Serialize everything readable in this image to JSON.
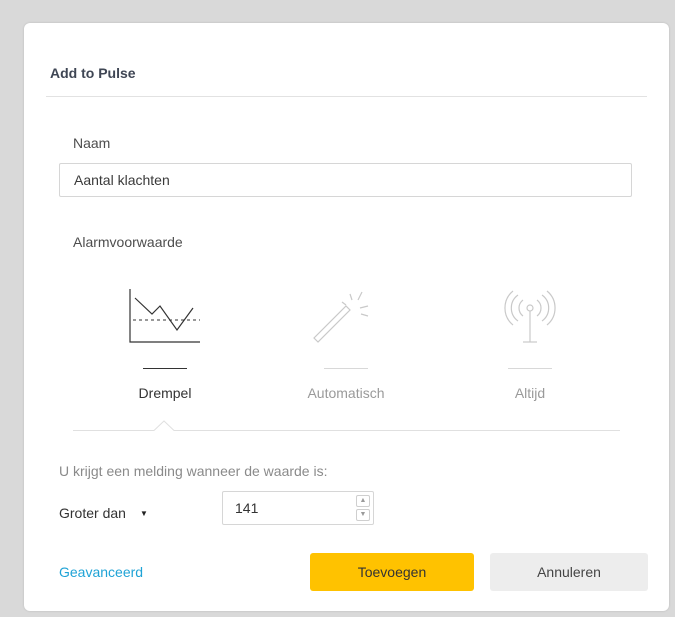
{
  "dialog": {
    "title": "Add to Pulse"
  },
  "name_field": {
    "label": "Naam",
    "value": "Aantal klachten"
  },
  "alarm": {
    "label": "Alarmvoorwaarde",
    "options": [
      {
        "label": "Drempel",
        "icon": "threshold-chart-icon",
        "selected": true
      },
      {
        "label": "Automatisch",
        "icon": "magic-wand-icon",
        "selected": false
      },
      {
        "label": "Altijd",
        "icon": "antenna-broadcast-icon",
        "selected": false
      }
    ]
  },
  "condition": {
    "text": "U krijgt een melding wanneer de waarde is:",
    "operator": "Groter dan",
    "value": "141"
  },
  "footer": {
    "advanced_link": "Geavanceerd",
    "add_button": "Toevoegen",
    "cancel_button": "Annuleren"
  },
  "colors": {
    "accent_yellow": "#ffc200",
    "link_blue": "#1fa3d6",
    "cancel_gray": "#ededed"
  }
}
